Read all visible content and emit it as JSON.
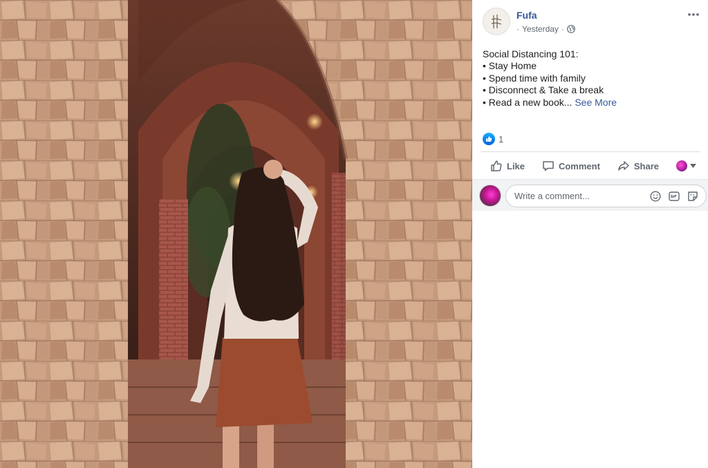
{
  "post": {
    "author": "Fufa",
    "time_prefix": "· ",
    "time": "Yesterday",
    "time_suffix": " ·",
    "privacy_icon": "globe-icon",
    "text_lines": [
      "Social Distancing 101:",
      "• Stay Home",
      "• Spend time with family",
      "• Disconnect & Take a break",
      "• Read a new book..."
    ],
    "see_more": "See More",
    "reaction_count": "1",
    "reaction_icon": "like-reaction-icon"
  },
  "actions": {
    "like": "Like",
    "comment": "Comment",
    "share": "Share"
  },
  "comment_box": {
    "placeholder": "Write a comment..."
  },
  "colors": {
    "link": "#385898",
    "secondary_text": "#606770",
    "like_blue": "#1877f2",
    "comment_bar_bg": "#f2f3f5"
  }
}
